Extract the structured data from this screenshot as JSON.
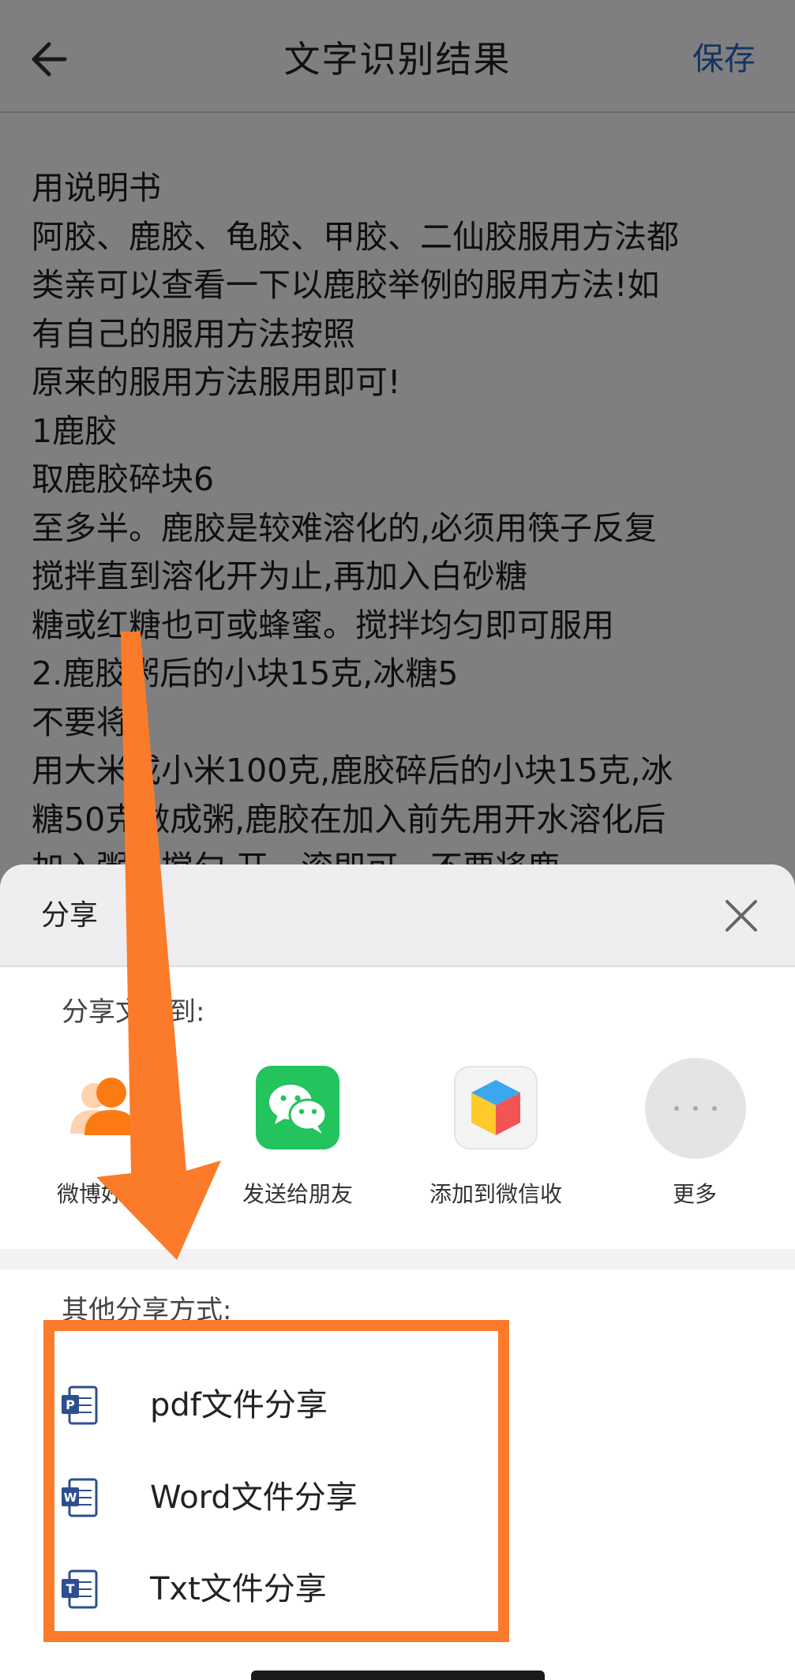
{
  "header": {
    "title": "文字识别结果",
    "save_label": "保存",
    "back_icon": "arrow-left-icon"
  },
  "ocr_text": {
    "lines": [
      "用说明书",
      "阿胶、鹿胶、龟胶、甲胶、二仙胶服用方法都",
      "类亲可以查看一下以鹿胶举例的服用方法!如",
      "有自己的服用方法按照",
      "原来的服用方法服用即可!",
      "1鹿胶",
      "取鹿胶碎块6",
      "至多半。鹿胶是较难溶化的,必须用筷子反复",
      "搅拌直到溶化开为止,再加入白砂糖",
      "糖或红糖也可或蜂蜜。搅拌均匀即可服用",
      "2.鹿胶粥后的小块15克,冰糖5",
      "不要将",
      "用大米或小米100克,鹿胶碎后的小块15克,冰",
      "糖50克做成粥,鹿胶在加入前先用开水溶化后",
      "加入粥中搅匀,开一滚即可。不要将鹿"
    ]
  },
  "share_sheet": {
    "title": "分享",
    "close_icon": "close-icon",
    "share_to_label": "分享文本到:",
    "targets": [
      {
        "label": "微博好友",
        "icon": "weibo-friend-icon"
      },
      {
        "label": "发送给朋友",
        "icon": "wechat-icon"
      },
      {
        "label": "添加到微信收",
        "icon": "wechat-favorites-icon"
      },
      {
        "label": "更多",
        "icon": "more-icon"
      }
    ],
    "other_label": "其他分享方式:",
    "file_options": [
      {
        "label": "pdf文件分享",
        "icon": "pdf-file-icon",
        "letter": "P"
      },
      {
        "label": "Word文件分享",
        "icon": "word-file-icon",
        "letter": "W"
      },
      {
        "label": "Txt文件分享",
        "icon": "txt-file-icon",
        "letter": "T"
      }
    ]
  },
  "colors": {
    "accent_blue": "#2a66c6",
    "annotation_orange": "#fb7b2a",
    "wechat_green": "#23c35d",
    "file_icon_blue": "#2e4f8f"
  }
}
